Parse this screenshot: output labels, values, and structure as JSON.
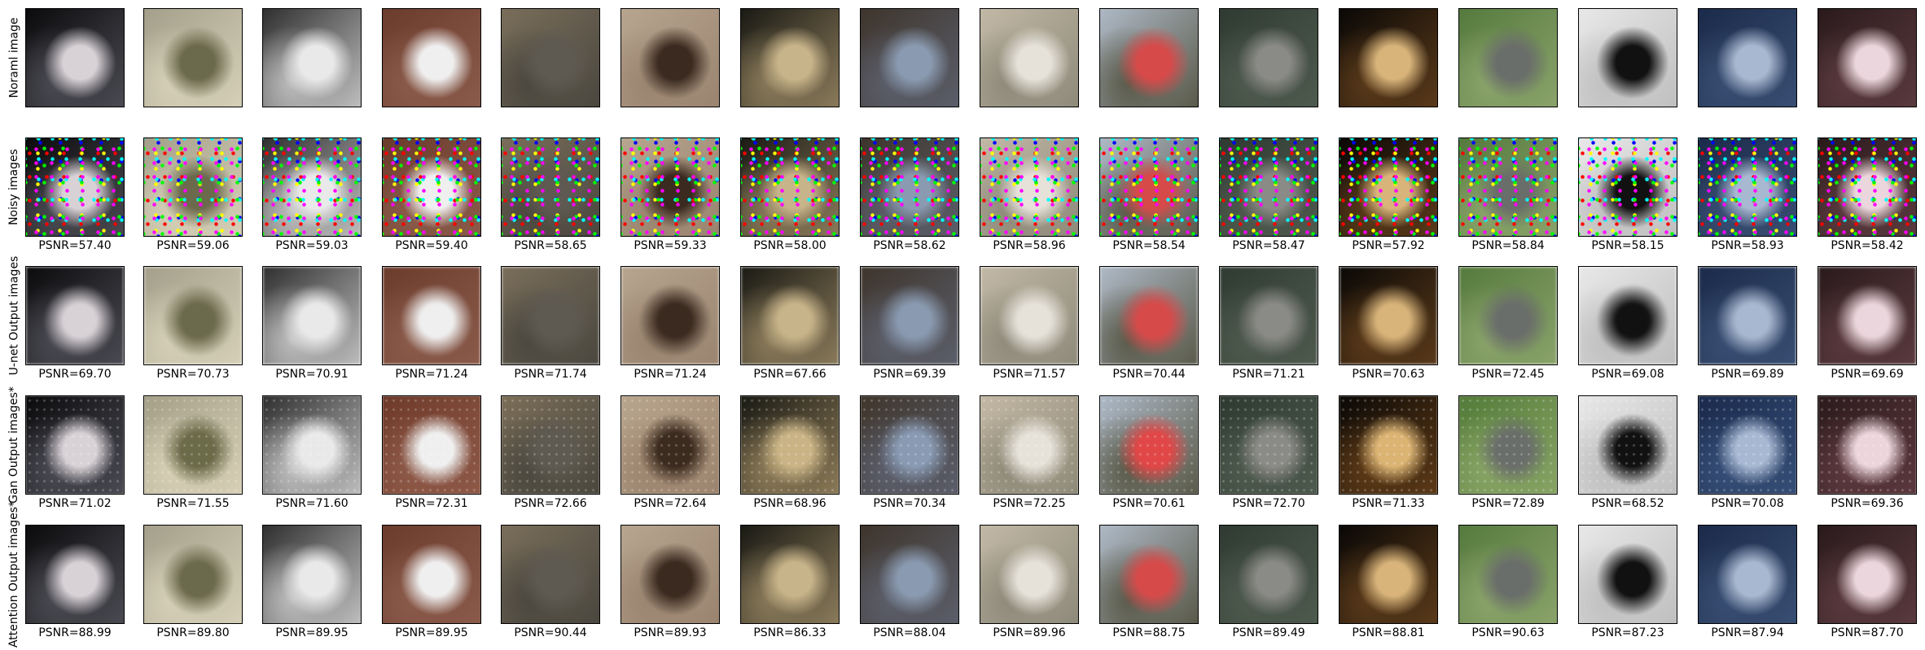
{
  "rows": [
    {
      "label": "Noraml image",
      "psnr": []
    },
    {
      "label": "Noisy images",
      "psnr": [
        "PSNR=57.40",
        "PSNR=59.06",
        "PSNR=59.03",
        "PSNR=59.40",
        "PSNR=58.65",
        "PSNR=59.33",
        "PSNR=58.00",
        "PSNR=58.62",
        "PSNR=58.96",
        "PSNR=58.54",
        "PSNR=58.47",
        "PSNR=57.92",
        "PSNR=58.84",
        "PSNR=58.15",
        "PSNR=58.93",
        "PSNR=58.42"
      ]
    },
    {
      "label": "U-net Output images",
      "psnr": [
        "PSNR=69.70",
        "PSNR=70.73",
        "PSNR=70.91",
        "PSNR=71.24",
        "PSNR=71.74",
        "PSNR=71.24",
        "PSNR=67.66",
        "PSNR=69.39",
        "PSNR=71.57",
        "PSNR=70.44",
        "PSNR=71.21",
        "PSNR=70.63",
        "PSNR=72.45",
        "PSNR=69.08",
        "PSNR=69.89",
        "PSNR=69.69"
      ]
    },
    {
      "label": "Gan Output images*",
      "psnr": [
        "PSNR=71.02",
        "PSNR=71.55",
        "PSNR=71.60",
        "PSNR=72.31",
        "PSNR=72.66",
        "PSNR=72.64",
        "PSNR=68.96",
        "PSNR=70.34",
        "PSNR=72.25",
        "PSNR=70.61",
        "PSNR=72.70",
        "PSNR=71.33",
        "PSNR=72.89",
        "PSNR=68.52",
        "PSNR=70.08",
        "PSNR=69.36"
      ]
    },
    {
      "label": "Attention Output images*",
      "psnr": [
        "PSNR=88.99",
        "PSNR=89.80",
        "PSNR=89.95",
        "PSNR=89.95",
        "PSNR=90.44",
        "PSNR=89.93",
        "PSNR=86.33",
        "PSNR=88.04",
        "PSNR=89.96",
        "PSNR=88.75",
        "PSNR=89.49",
        "PSNR=88.81",
        "PSNR=90.63",
        "PSNR=87.23",
        "PSNR=87.94",
        "PSNR=87.70"
      ]
    }
  ],
  "image_colors": [
    [
      "#0b0b0d",
      "#d8d2d6",
      "#4a4a52"
    ],
    [
      "#a49f8a",
      "#6b6a4c",
      "#d6d0b8"
    ],
    [
      "#303030",
      "#e9e9e9",
      "#bdbdbd"
    ],
    [
      "#6b3b2c",
      "#efefef",
      "#8a5a4a"
    ],
    [
      "#7a6e5a",
      "#5e5a52",
      "#4a473f"
    ],
    [
      "#b7a58f",
      "#3a2a1f",
      "#9a8470"
    ],
    [
      "#1a1a14",
      "#c8b48a",
      "#8a7a5a"
    ],
    [
      "#3e352c",
      "#8a9ab0",
      "#5b5e6a"
    ],
    [
      "#c2b8a6",
      "#e6e2da",
      "#8e8a7a"
    ],
    [
      "#aeb9c6",
      "#d64a4a",
      "#5a5a4a"
    ],
    [
      "#2f3a32",
      "#8a8a86",
      "#4f5a4e"
    ],
    [
      "#0a0806",
      "#d8b47a",
      "#5a3a1a"
    ],
    [
      "#557a3e",
      "#6a6e6a",
      "#8aa36a"
    ],
    [
      "#e8e8e8",
      "#111111",
      "#bfbfbf"
    ],
    [
      "#1b2a4a",
      "#a8b8d0",
      "#384e72"
    ],
    [
      "#2a1a1c",
      "#ead6dc",
      "#5a3a3e"
    ]
  ]
}
